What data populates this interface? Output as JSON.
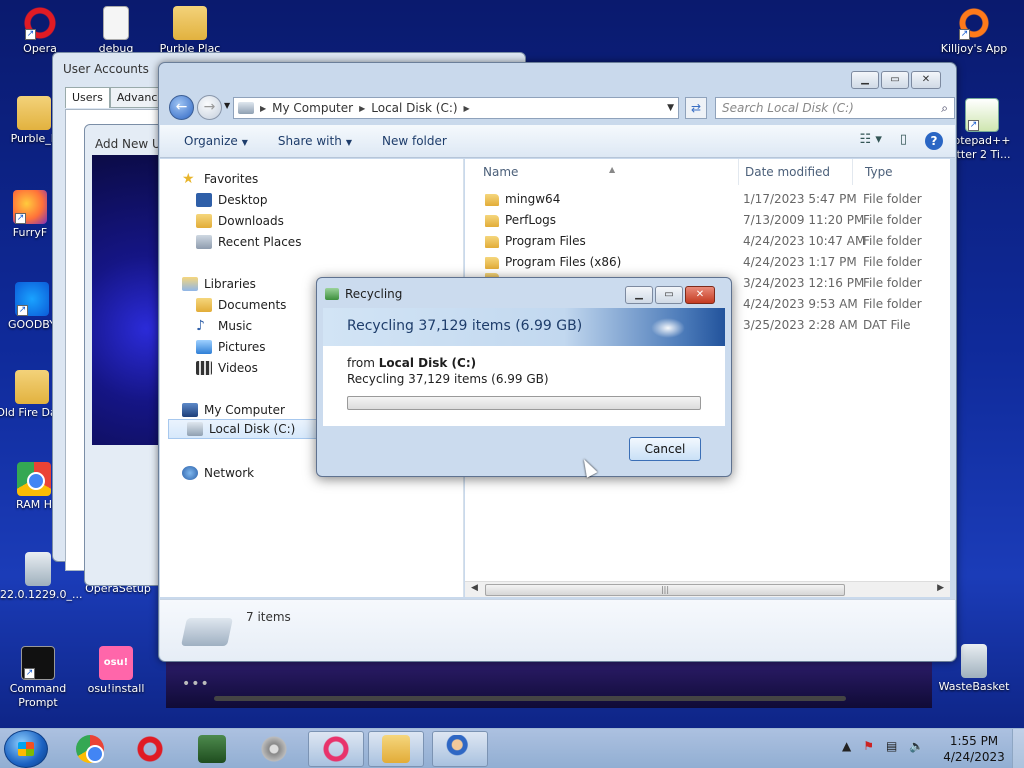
{
  "desktop": {
    "icons": [
      {
        "label": "Opera"
      },
      {
        "label": "debug"
      },
      {
        "label": "Purble Plac"
      },
      {
        "label": "Purble_P"
      },
      {
        "label": "FurryF"
      },
      {
        "label": "GOODBY"
      },
      {
        "label": "Old Fire Data"
      },
      {
        "label": "RAM H"
      },
      {
        "label": "22.0.1229.0_..."
      },
      {
        "label": "OperaSetup"
      },
      {
        "label": "Command Prompt"
      },
      {
        "label": "osu!install"
      },
      {
        "label": "Killjoy's App"
      },
      {
        "label": "otepad++ itter 2 Ti..."
      },
      {
        "label": "WasteBasket"
      }
    ],
    "osu_text": "osu!"
  },
  "user_accounts": {
    "title": "User Accounts",
    "tabs": [
      "Users",
      "Advanced"
    ],
    "add_user_title": "Add New U"
  },
  "explorer": {
    "breadcrumb": [
      "My Computer",
      "Local Disk (C:)"
    ],
    "search_placeholder": "Search Local Disk (C:)",
    "toolbar": {
      "organize": "Organize",
      "share_with": "Share with",
      "new_folder": "New folder"
    },
    "nav": {
      "favorites": "Favorites",
      "desktop": "Desktop",
      "downloads": "Downloads",
      "recent_places": "Recent Places",
      "libraries": "Libraries",
      "documents": "Documents",
      "music": "Music",
      "pictures": "Pictures",
      "videos": "Videos",
      "my_computer": "My Computer",
      "local_disk": "Local Disk (C:)",
      "network": "Network"
    },
    "columns": {
      "name": "Name",
      "date": "Date modified",
      "type": "Type"
    },
    "files": [
      {
        "name": "mingw64",
        "date": "1/17/2023 5:47 PM",
        "type": "File folder"
      },
      {
        "name": "PerfLogs",
        "date": "7/13/2009 11:20 PM",
        "type": "File folder"
      },
      {
        "name": "Program Files",
        "date": "4/24/2023 10:47 AM",
        "type": "File folder"
      },
      {
        "name": "Program Files (x86)",
        "date": "4/24/2023 1:17 PM",
        "type": "File folder"
      },
      {
        "name": "",
        "date": "3/24/2023 12:16 PM",
        "type": "File folder"
      },
      {
        "name": "",
        "date": "4/24/2023 9:53 AM",
        "type": "File folder"
      },
      {
        "name": "",
        "date": "3/25/2023 2:28 AM",
        "type": "DAT File"
      }
    ],
    "item_count": "7 items"
  },
  "dialog": {
    "title": "Recycling",
    "heading": "Recycling 37,129 items (6.99 GB)",
    "from_prefix": "from",
    "from_source": "Local Disk (C:)",
    "detail": "Recycling 37,129 items (6.99 GB)",
    "progress": 0,
    "cancel_label": "Cancel"
  },
  "taskbar": {
    "time": "1:55 PM",
    "date": "4/24/2023"
  },
  "colors": {
    "accent": "#2f67c4",
    "progress_green": "#32a626",
    "close_red": "#c43b21"
  }
}
